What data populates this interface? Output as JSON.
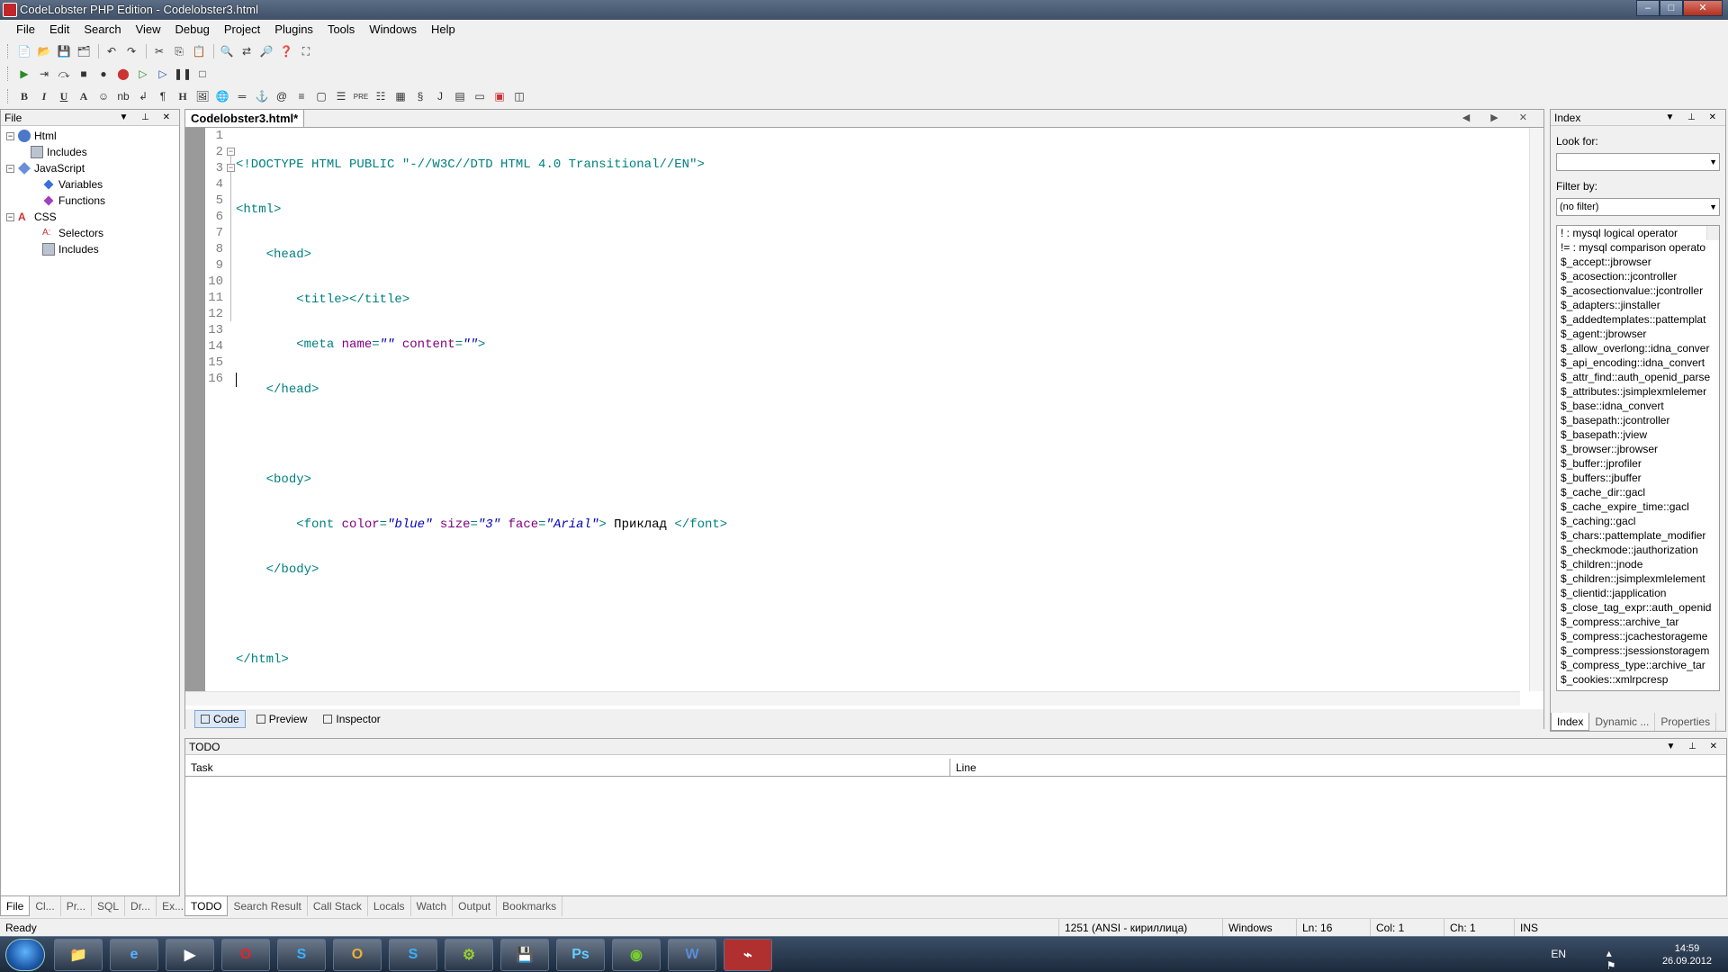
{
  "window": {
    "title": "CodeLobster PHP Edition - Codelobster3.html",
    "controls": [
      "–",
      "□",
      "✕"
    ]
  },
  "menu": [
    "File",
    "Edit",
    "Search",
    "View",
    "Debug",
    "Project",
    "Plugins",
    "Tools",
    "Windows",
    "Help"
  ],
  "file_panel": {
    "title": "File",
    "tree": [
      {
        "label": "Html",
        "level": 0,
        "icon": "html-icon"
      },
      {
        "label": "Includes",
        "level": 1,
        "icon": "includes-icon"
      },
      {
        "label": "JavaScript",
        "level": 0,
        "icon": "javascript-icon"
      },
      {
        "label": "Variables",
        "level": 1,
        "icon": "variable-icon"
      },
      {
        "label": "Functions",
        "level": 1,
        "icon": "function-icon"
      },
      {
        "label": "CSS",
        "level": 0,
        "icon": "css-icon"
      },
      {
        "label": "Selectors",
        "level": 1,
        "icon": "selector-icon"
      },
      {
        "label": "Includes",
        "level": 1,
        "icon": "includes-icon"
      }
    ],
    "tabs": [
      "File",
      "Cl...",
      "Pr...",
      "SQL",
      "Dr...",
      "Ex..."
    ]
  },
  "editor": {
    "tab": "Codelobster3.html*",
    "line_numbers": [
      "1",
      "2",
      "3",
      "4",
      "5",
      "6",
      "7",
      "8",
      "9",
      "10",
      "11",
      "12",
      "13",
      "14",
      "15",
      "16"
    ],
    "view_tabs": [
      "Code",
      "Preview",
      "Inspector"
    ]
  },
  "index_panel": {
    "title": "Index",
    "look_for_label": "Look for:",
    "look_for_value": "",
    "filter_label": "Filter by:",
    "filter_value": "(no filter)",
    "items": [
      "! : mysql logical operator",
      "!= : mysql comparison operato",
      "$_accept::jbrowser",
      "$_acosection::jcontroller",
      "$_acosectionvalue::jcontroller",
      "$_adapters::jinstaller",
      "$_addedtemplates::pattemplat",
      "$_agent::jbrowser",
      "$_allow_overlong::idna_conver",
      "$_api_encoding::idna_convert",
      "$_attr_find::auth_openid_parse",
      "$_attributes::jsimplexmlelemer",
      "$_base::idna_convert",
      "$_basepath::jcontroller",
      "$_basepath::jview",
      "$_browser::jbrowser",
      "$_buffer::jprofiler",
      "$_buffers::jbuffer",
      "$_cache_dir::gacl",
      "$_cache_expire_time::gacl",
      "$_caching::gacl",
      "$_chars::pattemplate_modifier",
      "$_checkmode::jauthorization",
      "$_children::jnode",
      "$_children::jsimplexmlelement",
      "$_clientid::japplication",
      "$_close_tag_expr::auth_openid",
      "$_compress::archive_tar",
      "$_compress::jcachestorageme",
      "$_compress::jsessionstoragem",
      "$_compress_type::archive_tar",
      "$_cookies::xmlrpcresp"
    ],
    "tabs": [
      "Index",
      "Dynamic ...",
      "Properties"
    ]
  },
  "todo_panel": {
    "title": "TODO",
    "columns": [
      "Task",
      "Line"
    ],
    "tabs": [
      "TODO",
      "Search Result",
      "Call Stack",
      "Locals",
      "Watch",
      "Output",
      "Bookmarks"
    ]
  },
  "status": {
    "ready": "Ready",
    "encoding": "1251 (ANSI - кириллица)",
    "line_ending": "Windows",
    "ln": "Ln: 16",
    "col": "Col: 1",
    "ch": "Ch: 1",
    "mode": "INS"
  },
  "taskbar": {
    "lang": "EN",
    "time": "14:59",
    "date": "26.09.2012",
    "apps": [
      "explorer",
      "ie",
      "media",
      "opera",
      "skype",
      "outlook",
      "skype2",
      "app",
      "save",
      "Ps",
      "app2",
      "W",
      "codelobster"
    ]
  }
}
